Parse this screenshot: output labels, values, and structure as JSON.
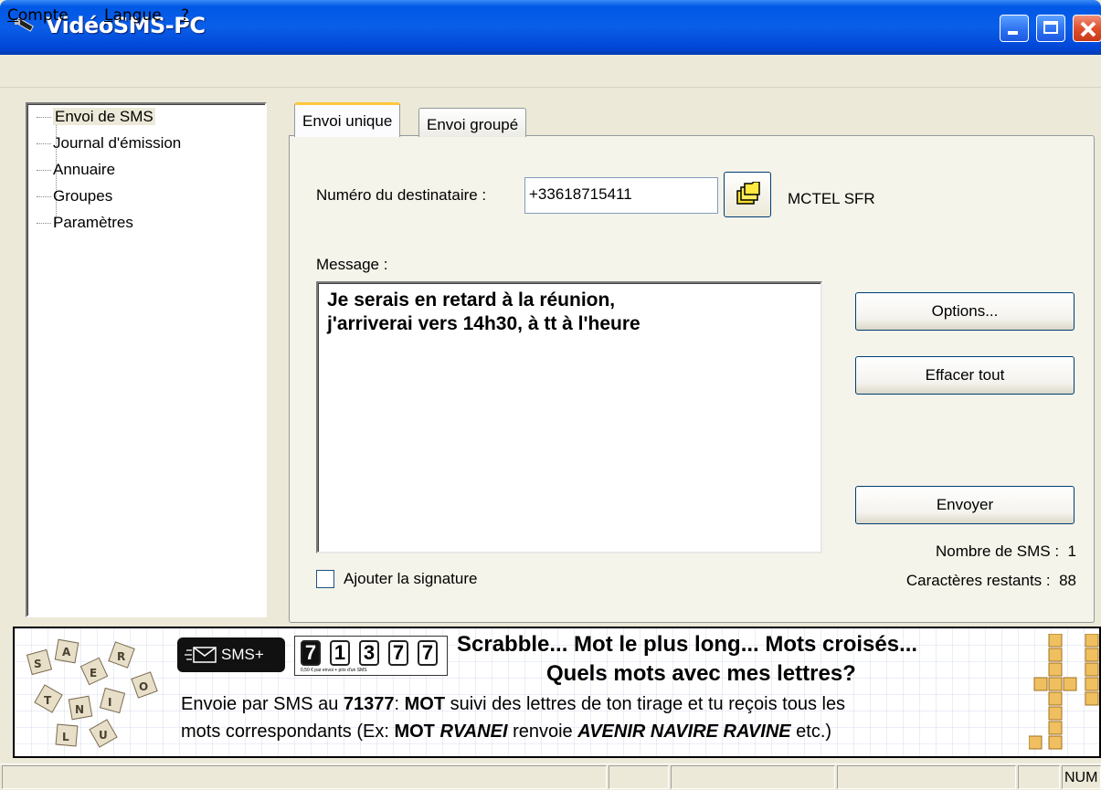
{
  "window": {
    "title": "VidéoSMS-PC"
  },
  "menu": {
    "items": [
      {
        "label_u": "C",
        "label_rest": "ompte"
      },
      {
        "label_u": "L",
        "label_rest": "angue"
      },
      {
        "label_u": "?",
        "label_rest": ""
      }
    ]
  },
  "tree": {
    "items": [
      "Envoi de SMS",
      "Journal d'émission",
      "Annuaire",
      "Groupes",
      "Paramètres"
    ],
    "selected": "Envoi de SMS"
  },
  "tabs": {
    "unique": "Envoi unique",
    "groupe": "Envoi groupé"
  },
  "form": {
    "recipient_label": "Numéro du destinataire :",
    "recipient_value": "+33618715411",
    "operator": "MCTEL SFR",
    "message_label": "Message :",
    "message_line1": "Je serais en retard à la réunion,",
    "message_line2": "j'arriverai vers 14h30, à tt à l'heure",
    "signature_label": "Ajouter la signature",
    "signature_checked": false
  },
  "buttons": {
    "options": "Options...",
    "clear": "Effacer tout",
    "send": "Envoyer"
  },
  "counters": {
    "sms_label": "Nombre de SMS :",
    "sms_value": "1",
    "chars_label": "Caractères restants :",
    "chars_value": "88"
  },
  "ad": {
    "badge": "SMS+",
    "code_digits": [
      "7",
      "1",
      "3",
      "7",
      "7"
    ],
    "code_note": "0,50 € par envoi + prix d'un SMS",
    "headline1": "Scrabble... Mot le plus long... Mots croisés...",
    "headline2": "Quels mots avec mes lettres?",
    "line1_a": "Envoie par SMS au ",
    "line1_b": "71377",
    "line1_c": ": ",
    "line1_d": "MOT",
    "line1_e": " suivi des lettres de ton tirage et tu reçois tous les",
    "line2_a": "mots correspondants (Ex: ",
    "line2_b": "MOT",
    "line2_c": "RVANEI",
    "line2_d": " renvoie ",
    "line2_e": "AVENIR NAVIRE RAVINE",
    "line2_f": " etc.",
    "line2_g": ")"
  },
  "status": {
    "num": "NUM"
  },
  "colors": {
    "titlebar": "#0a5ee8",
    "window_bg": "#ece9d8",
    "tab_accent": "#ffc83c"
  }
}
